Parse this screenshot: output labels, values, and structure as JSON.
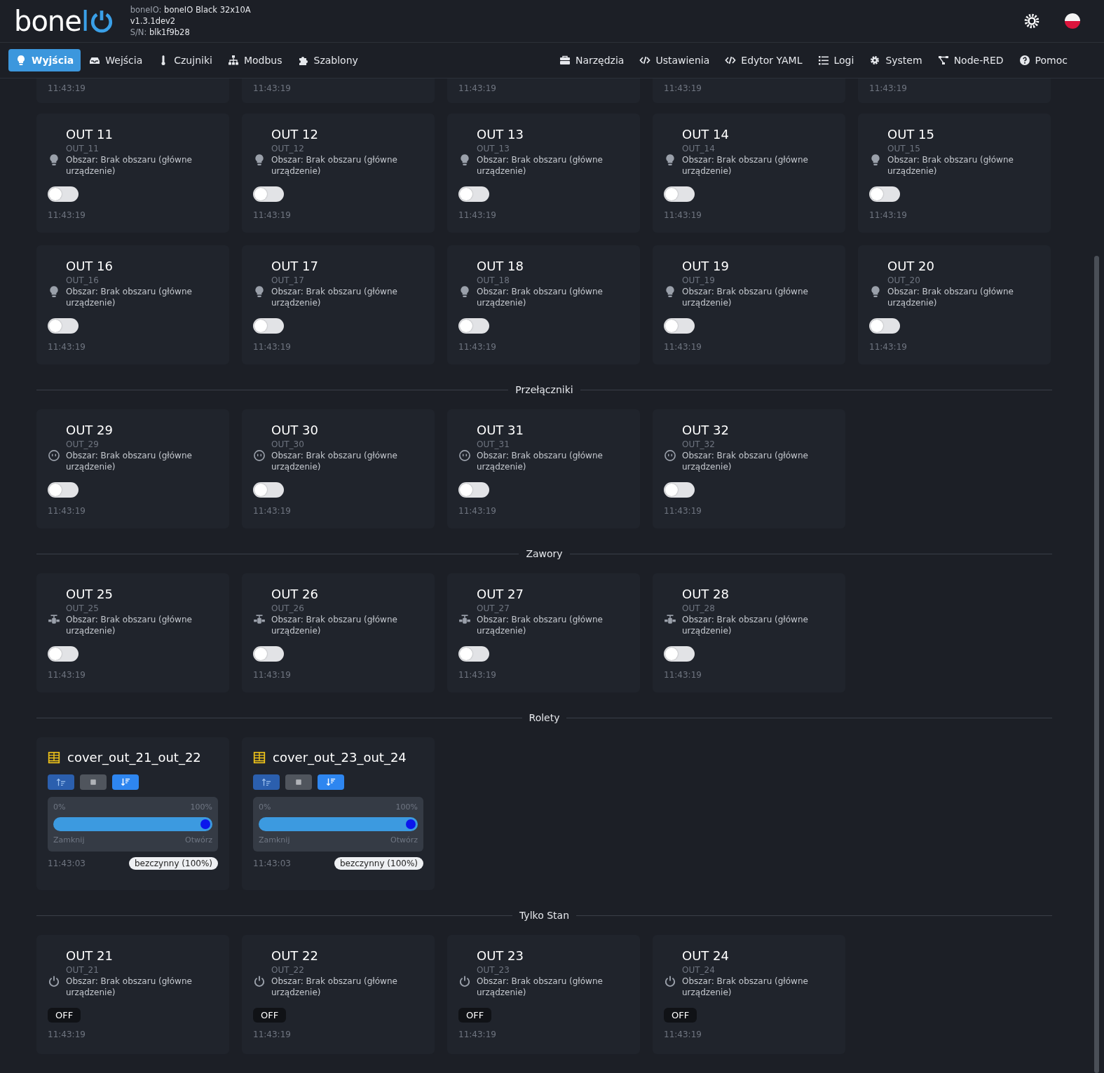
{
  "logo": {
    "text": "bone",
    "accent": "I"
  },
  "device": {
    "name_label": "boneIO:",
    "name": "boneIO Black 32x10A",
    "version": "v1.3.1dev2",
    "serial_label": "S/N:",
    "serial": "blk1f9b28"
  },
  "nav": {
    "left": [
      {
        "label": "Wyjścia",
        "selected": true
      },
      {
        "label": "Wejścia",
        "selected": false
      },
      {
        "label": "Czujniki",
        "selected": false
      },
      {
        "label": "Modbus",
        "selected": false
      },
      {
        "label": "Szablony",
        "selected": false
      }
    ],
    "right": [
      {
        "label": "Narzędzia",
        "selected": false
      },
      {
        "label": "Ustawienia",
        "selected": false
      },
      {
        "label": "Edytor YAML",
        "selected": false
      },
      {
        "label": "Logi",
        "selected": false
      },
      {
        "label": "System",
        "selected": false
      },
      {
        "label": "Node-RED",
        "selected": false
      },
      {
        "label": "Pomoc",
        "selected": false
      }
    ]
  },
  "clipped_row": [
    {
      "time": "11:43:19"
    },
    {
      "time": "11:43:19"
    },
    {
      "time": "11:43:19"
    },
    {
      "time": "11:43:19"
    },
    {
      "time": "11:43:19"
    }
  ],
  "sections": [
    {
      "kind": "light",
      "items": [
        {
          "kind": "switch",
          "name": "OUT 11",
          "id": "OUT_11",
          "area": "Obszar: Brak obszaru (główne urządzenie)",
          "on": false,
          "time": "11:43:19"
        },
        {
          "kind": "switch",
          "name": "OUT 12",
          "id": "OUT_12",
          "area": "Obszar: Brak obszaru (główne urządzenie)",
          "on": false,
          "time": "11:43:19"
        },
        {
          "kind": "switch",
          "name": "OUT 13",
          "id": "OUT_13",
          "area": "Obszar: Brak obszaru (główne urządzenie)",
          "on": false,
          "time": "11:43:19"
        },
        {
          "kind": "switch",
          "name": "OUT 14",
          "id": "OUT_14",
          "area": "Obszar: Brak obszaru (główne urządzenie)",
          "on": false,
          "time": "11:43:19"
        },
        {
          "kind": "switch",
          "name": "OUT 15",
          "id": "OUT_15",
          "area": "Obszar: Brak obszaru (główne urządzenie)",
          "on": false,
          "time": "11:43:19"
        },
        {
          "kind": "switch",
          "name": "OUT 16",
          "id": "OUT_16",
          "area": "Obszar: Brak obszaru (główne urządzenie)",
          "on": false,
          "time": "11:43:19"
        },
        {
          "kind": "switch",
          "name": "OUT 17",
          "id": "OUT_17",
          "area": "Obszar: Brak obszaru (główne urządzenie)",
          "on": false,
          "time": "11:43:19"
        },
        {
          "kind": "switch",
          "name": "OUT 18",
          "id": "OUT_18",
          "area": "Obszar: Brak obszaru (główne urządzenie)",
          "on": false,
          "time": "11:43:19"
        },
        {
          "kind": "switch",
          "name": "OUT 19",
          "id": "OUT_19",
          "area": "Obszar: Brak obszaru (główne urządzenie)",
          "on": false,
          "time": "11:43:19"
        },
        {
          "kind": "switch",
          "name": "OUT 20",
          "id": "OUT_20",
          "area": "Obszar: Brak obszaru (główne urządzenie)",
          "on": false,
          "time": "11:43:19"
        }
      ]
    },
    {
      "kind": "switch",
      "title": "Przełączniki",
      "items": [
        {
          "kind": "switch",
          "name": "OUT 29",
          "id": "OUT_29",
          "area": "Obszar: Brak obszaru (główne urządzenie)",
          "on": false,
          "time": "11:43:19"
        },
        {
          "kind": "switch",
          "name": "OUT 30",
          "id": "OUT_30",
          "area": "Obszar: Brak obszaru (główne urządzenie)",
          "on": false,
          "time": "11:43:19"
        },
        {
          "kind": "switch",
          "name": "OUT 31",
          "id": "OUT_31",
          "area": "Obszar: Brak obszaru (główne urządzenie)",
          "on": false,
          "time": "11:43:19"
        },
        {
          "kind": "switch",
          "name": "OUT 32",
          "id": "OUT_32",
          "area": "Obszar: Brak obszaru (główne urządzenie)",
          "on": false,
          "time": "11:43:19"
        }
      ]
    },
    {
      "kind": "valve",
      "title": "Zawory",
      "items": [
        {
          "kind": "switch",
          "name": "OUT 25",
          "id": "OUT_25",
          "area": "Obszar: Brak obszaru (główne urządzenie)",
          "on": false,
          "time": "11:43:19"
        },
        {
          "kind": "switch",
          "name": "OUT 26",
          "id": "OUT_26",
          "area": "Obszar: Brak obszaru (główne urządzenie)",
          "on": false,
          "time": "11:43:19"
        },
        {
          "kind": "switch",
          "name": "OUT 27",
          "id": "OUT_27",
          "area": "Obszar: Brak obszaru (główne urządzenie)",
          "on": false,
          "time": "11:43:19"
        },
        {
          "kind": "switch",
          "name": "OUT 28",
          "id": "OUT_28",
          "area": "Obszar: Brak obszaru (główne urządzenie)",
          "on": false,
          "time": "11:43:19"
        }
      ]
    },
    {
      "kind": "cover",
      "title": "Rolety",
      "items": [
        {
          "kind": "cover",
          "name": "cover_out_21_out_22",
          "min_label": "0%",
          "max_label": "100%",
          "close_label": "Zamknij",
          "open_label": "Otwórz",
          "level": 1,
          "time": "11:43:03",
          "status": "bezczynny (100%)"
        },
        {
          "kind": "cover",
          "name": "cover_out_23_out_24",
          "min_label": "0%",
          "max_label": "100%",
          "close_label": "Zamknij",
          "open_label": "Otwórz",
          "level": 1,
          "time": "11:43:03",
          "status": "bezczynny (100%)"
        }
      ]
    },
    {
      "kind": "state",
      "title": "Tylko Stan",
      "items": [
        {
          "kind": "state",
          "name": "OUT 21",
          "id": "OUT_21",
          "area": "Obszar: Brak obszaru (główne urządzenie)",
          "state": "OFF",
          "time": "11:43:19"
        },
        {
          "kind": "state",
          "name": "OUT 22",
          "id": "OUT_22",
          "area": "Obszar: Brak obszaru (główne urządzenie)",
          "state": "OFF",
          "time": "11:43:19"
        },
        {
          "kind": "state",
          "name": "OUT 23",
          "id": "OUT_23",
          "area": "Obszar: Brak obszaru (główne urządzenie)",
          "state": "OFF",
          "time": "11:43:19"
        },
        {
          "kind": "state",
          "name": "OUT 24",
          "id": "OUT_24",
          "area": "Obszar: Brak obszaru (główne urządzenie)",
          "state": "OFF",
          "time": "11:43:19"
        }
      ]
    }
  ]
}
